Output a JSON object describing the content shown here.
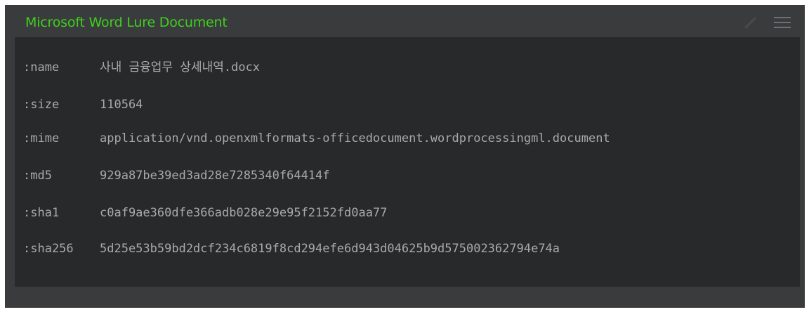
{
  "panel": {
    "title": "Microsoft Word Lure Document",
    "icons": {
      "edit": "pencil-icon",
      "menu": "hamburger-menu-icon"
    },
    "colors": {
      "title": "#3fcf1e",
      "panel_bg": "#3a3b3d",
      "content_bg": "#28292b",
      "text": "#a7a9ab"
    }
  },
  "fields": [
    {
      "key": ":name",
      "value": "사내 금융업무 상세내역.docx"
    },
    {
      "key": ":size",
      "value": "110564"
    },
    {
      "key": ":mime",
      "value": "application/vnd.openxmlformats-officedocument.wordprocessingml.document"
    },
    {
      "key": ":md5",
      "value": "929a87be39ed3ad28e7285340f64414f"
    },
    {
      "key": ":sha1",
      "value": "c0af9ae360dfe366adb028e29e95f2152fd0aa77"
    },
    {
      "key": ":sha256",
      "value": "5d25e53b59bd2dcf234c6819f8cd294efe6d943d04625b9d575002362794e74a"
    }
  ]
}
